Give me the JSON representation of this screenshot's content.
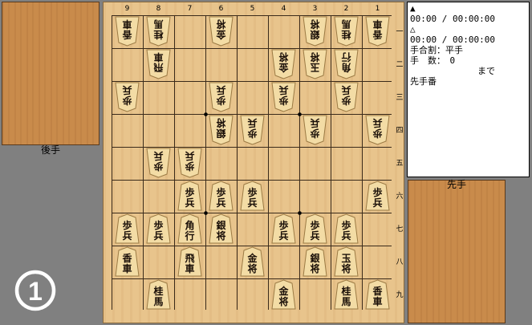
{
  "gote_label": "後手",
  "sente_label": "先手",
  "diagram_number": "1",
  "col_labels": [
    "9",
    "8",
    "7",
    "6",
    "5",
    "4",
    "3",
    "2",
    "1"
  ],
  "row_labels": [
    "一",
    "二",
    "三",
    "四",
    "五",
    "六",
    "七",
    "八",
    "九"
  ],
  "info": {
    "sente_mark": "▲",
    "sente_time": "00:00 / 00:00:00",
    "gote_mark": "△",
    "gote_time": "00:00 / 00:00:00",
    "handicap": "手合割：平手",
    "moves": "手　数：　0",
    "made": "まで",
    "turn": "先手番"
  },
  "colors": {
    "board": "#e8c48c",
    "stand": "#c98b4b",
    "piece": "#f3dca5",
    "background": "#808080"
  },
  "pieces": [
    {
      "col": 9,
      "row": 1,
      "side": "gote",
      "chars": [
        "香",
        "車"
      ]
    },
    {
      "col": 8,
      "row": 1,
      "side": "gote",
      "chars": [
        "桂",
        "馬"
      ]
    },
    {
      "col": 6,
      "row": 1,
      "side": "gote",
      "chars": [
        "金",
        "将"
      ]
    },
    {
      "col": 3,
      "row": 1,
      "side": "gote",
      "chars": [
        "銀",
        "将"
      ]
    },
    {
      "col": 2,
      "row": 1,
      "side": "gote",
      "chars": [
        "桂",
        "馬"
      ]
    },
    {
      "col": 1,
      "row": 1,
      "side": "gote",
      "chars": [
        "香",
        "車"
      ]
    },
    {
      "col": 8,
      "row": 2,
      "side": "gote",
      "chars": [
        "飛",
        "車"
      ]
    },
    {
      "col": 4,
      "row": 2,
      "side": "gote",
      "chars": [
        "金",
        "将"
      ]
    },
    {
      "col": 3,
      "row": 2,
      "side": "gote",
      "chars": [
        "玉",
        "将"
      ]
    },
    {
      "col": 2,
      "row": 2,
      "side": "gote",
      "chars": [
        "角",
        "行"
      ]
    },
    {
      "col": 9,
      "row": 3,
      "side": "gote",
      "chars": [
        "歩",
        "兵"
      ]
    },
    {
      "col": 6,
      "row": 3,
      "side": "gote",
      "chars": [
        "歩",
        "兵"
      ]
    },
    {
      "col": 4,
      "row": 3,
      "side": "gote",
      "chars": [
        "歩",
        "兵"
      ]
    },
    {
      "col": 2,
      "row": 3,
      "side": "gote",
      "chars": [
        "歩",
        "兵"
      ]
    },
    {
      "col": 6,
      "row": 4,
      "side": "gote",
      "chars": [
        "銀",
        "将"
      ]
    },
    {
      "col": 5,
      "row": 4,
      "side": "gote",
      "chars": [
        "歩",
        "兵"
      ]
    },
    {
      "col": 3,
      "row": 4,
      "side": "gote",
      "chars": [
        "歩",
        "兵"
      ]
    },
    {
      "col": 1,
      "row": 4,
      "side": "gote",
      "chars": [
        "歩",
        "兵"
      ]
    },
    {
      "col": 8,
      "row": 5,
      "side": "gote",
      "chars": [
        "歩",
        "兵"
      ]
    },
    {
      "col": 7,
      "row": 5,
      "side": "gote",
      "chars": [
        "歩",
        "兵"
      ]
    },
    {
      "col": 7,
      "row": 6,
      "side": "sente",
      "chars": [
        "歩",
        "兵"
      ]
    },
    {
      "col": 6,
      "row": 6,
      "side": "sente",
      "chars": [
        "歩",
        "兵"
      ]
    },
    {
      "col": 5,
      "row": 6,
      "side": "sente",
      "chars": [
        "歩",
        "兵"
      ]
    },
    {
      "col": 1,
      "row": 6,
      "side": "sente",
      "chars": [
        "歩",
        "兵"
      ]
    },
    {
      "col": 9,
      "row": 7,
      "side": "sente",
      "chars": [
        "歩",
        "兵"
      ]
    },
    {
      "col": 8,
      "row": 7,
      "side": "sente",
      "chars": [
        "歩",
        "兵"
      ]
    },
    {
      "col": 7,
      "row": 7,
      "side": "sente",
      "chars": [
        "角",
        "行"
      ]
    },
    {
      "col": 6,
      "row": 7,
      "side": "sente",
      "chars": [
        "銀",
        "将"
      ]
    },
    {
      "col": 4,
      "row": 7,
      "side": "sente",
      "chars": [
        "歩",
        "兵"
      ]
    },
    {
      "col": 3,
      "row": 7,
      "side": "sente",
      "chars": [
        "歩",
        "兵"
      ]
    },
    {
      "col": 2,
      "row": 7,
      "side": "sente",
      "chars": [
        "歩",
        "兵"
      ]
    },
    {
      "col": 9,
      "row": 8,
      "side": "sente",
      "chars": [
        "香",
        "車"
      ]
    },
    {
      "col": 7,
      "row": 8,
      "side": "sente",
      "chars": [
        "飛",
        "車"
      ]
    },
    {
      "col": 5,
      "row": 8,
      "side": "sente",
      "chars": [
        "金",
        "将"
      ]
    },
    {
      "col": 3,
      "row": 8,
      "side": "sente",
      "chars": [
        "銀",
        "将"
      ]
    },
    {
      "col": 2,
      "row": 8,
      "side": "sente",
      "chars": [
        "玉",
        "将"
      ]
    },
    {
      "col": 8,
      "row": 9,
      "side": "sente",
      "chars": [
        "桂",
        "馬"
      ]
    },
    {
      "col": 4,
      "row": 9,
      "side": "sente",
      "chars": [
        "金",
        "将"
      ]
    },
    {
      "col": 2,
      "row": 9,
      "side": "sente",
      "chars": [
        "桂",
        "馬"
      ]
    },
    {
      "col": 1,
      "row": 9,
      "side": "sente",
      "chars": [
        "香",
        "車"
      ]
    }
  ]
}
